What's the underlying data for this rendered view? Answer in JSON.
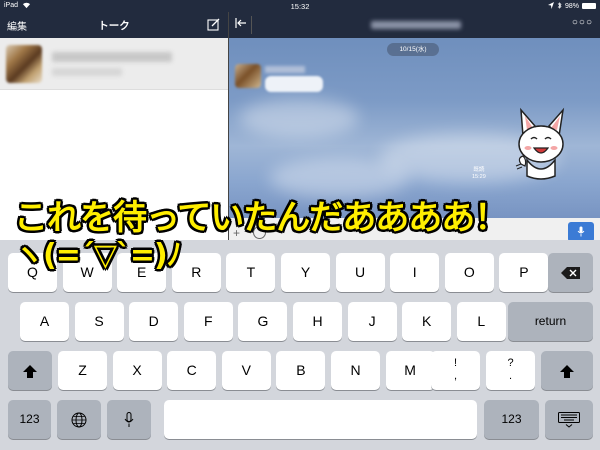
{
  "status_bar": {
    "carrier": "iPad",
    "wifi_icon": "wifi-icon",
    "time": "15:32",
    "battery": "98%",
    "battery_level": 0.98
  },
  "sidebar": {
    "edit_label": "編集",
    "title": "トーク",
    "compose_icon": "compose-icon"
  },
  "chat": {
    "back_icon": "back-arrow-icon",
    "more_icon": "more-icon",
    "date": "10/15(水)",
    "read_label": "既読",
    "read_time": "15:29"
  },
  "input": {
    "plus_icon": "plus-icon",
    "emoji_icon": "emoji-icon",
    "mic_icon": "microphone-icon"
  },
  "caption": {
    "line1": "これを待っていたんだああああ！",
    "line2": "ヽ(=´▽`=)ﾉ"
  },
  "keyboard": {
    "row1": [
      "Q",
      "W",
      "E",
      "R",
      "T",
      "Y",
      "U",
      "I",
      "O",
      "P"
    ],
    "row2": [
      "A",
      "S",
      "D",
      "F",
      "G",
      "H",
      "J",
      "K",
      "L"
    ],
    "row3": [
      "Z",
      "X",
      "C",
      "V",
      "B",
      "N",
      "M"
    ],
    "return_label": "return",
    "numbers_label": "123",
    "exclaim_top": "!",
    "exclaim_bottom": ",",
    "question_top": "?",
    "question_bottom": ".",
    "delete_icon": "delete-icon",
    "shift_icon": "shift-icon",
    "globe_icon": "globe-icon",
    "dictation_icon": "microphone-icon",
    "hide_keyboard_icon": "hide-keyboard-icon"
  },
  "colors": {
    "header": "#222b3e",
    "caption_text": "#ffee00",
    "mic_button": "#3b7bd5"
  }
}
